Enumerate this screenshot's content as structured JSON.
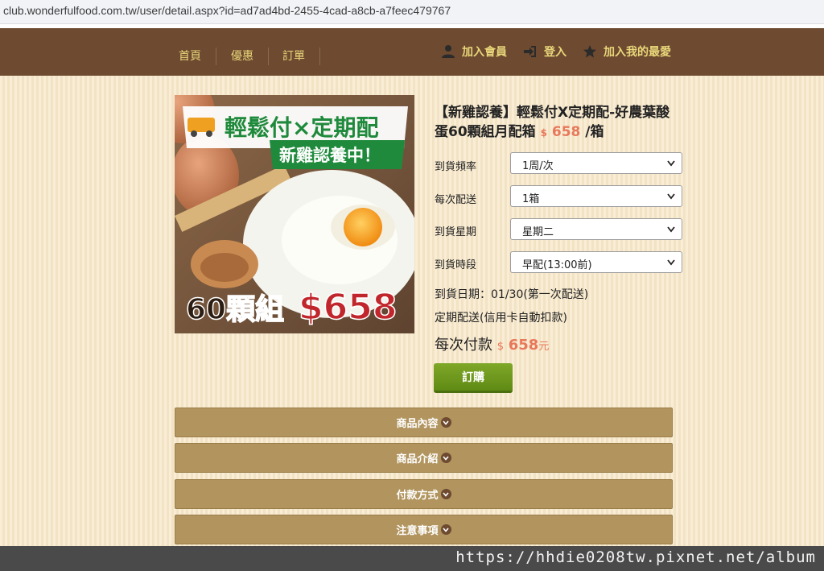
{
  "browser": {
    "url": "club.wonderfulfood.com.tw/user/detail.aspx?id=ad7ad4bd-2455-4cad-a8cb-a7feec479767"
  },
  "nav": {
    "items": [
      "首頁",
      "優惠",
      "訂單"
    ]
  },
  "header_actions": {
    "join": "加入會員",
    "login": "登入",
    "favorite": "加入我的最愛"
  },
  "product": {
    "image_text": {
      "banner": "輕鬆付×定期配",
      "sub_banner": "新雞認養中！",
      "bottom_left": "60顆組",
      "bottom_price": "$658"
    },
    "title": "【新雞認養】輕鬆付X定期配-好農葉酸蛋60顆組月配箱",
    "price_currency": "$",
    "price": "658",
    "price_unit": "/箱",
    "options": [
      {
        "label": "到貨頻率",
        "value": "1周/次"
      },
      {
        "label": "每次配送",
        "value": "1箱"
      },
      {
        "label": "到貨星期",
        "value": "星期二"
      },
      {
        "label": "到貨時段",
        "value": "早配(13:00前)"
      }
    ],
    "delivery_date": "到貨日期：01/30(第一次配送)",
    "payment_note": "定期配送(信用卡自動扣款)",
    "per_payment_label": "每次付款",
    "per_payment_currency": "$",
    "per_payment_amount": "658",
    "per_payment_unit": "元",
    "order_button": "訂購"
  },
  "accordion": [
    "商品內容",
    "商品介紹",
    "付款方式",
    "注意事項"
  ],
  "watermark": "https://hhdie0208tw.pixnet.net/album",
  "colors": {
    "header_bg": "#6d4a30",
    "nav_text": "#e9d77a",
    "price": "#e8785a",
    "order_button": "#6f9a1e",
    "accordion_bg": "#b1945e"
  }
}
